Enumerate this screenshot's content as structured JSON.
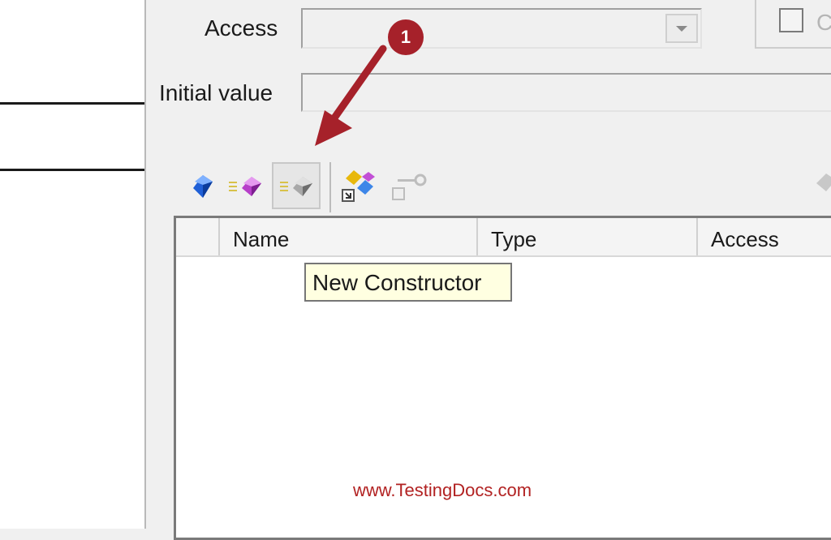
{
  "form": {
    "access_label": "Access",
    "access_value": "",
    "initial_value_label": "Initial value",
    "initial_value": "",
    "checkbox_label": "C"
  },
  "toolbar": {
    "items": [
      {
        "name": "new-attribute",
        "icon": "blue-cube-icon"
      },
      {
        "name": "new-method",
        "icon": "purple-cube-icon"
      },
      {
        "name": "new-constructor",
        "icon": "gray-cube-icon"
      },
      {
        "name": "override",
        "icon": "shapes-icon"
      },
      {
        "name": "accessor",
        "icon": "key-icon"
      }
    ],
    "tooltip": "New Constructor"
  },
  "grid": {
    "columns": [
      "Name",
      "Type",
      "Access"
    ],
    "rows": []
  },
  "annotation": {
    "step": "1",
    "color": "#a6212a"
  },
  "watermark": "www.TestingDocs.com"
}
